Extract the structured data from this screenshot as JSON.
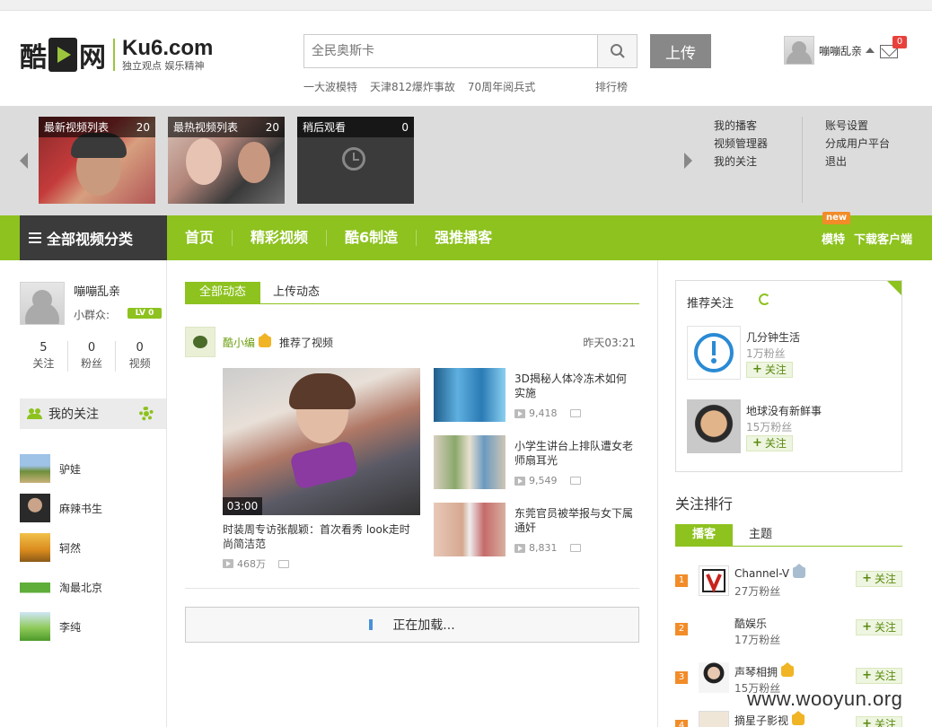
{
  "header": {
    "logo_cn1": "酷",
    "logo_cn2": "网",
    "logo_en": "Ku6.com",
    "logo_slogan": "独立观点 娱乐精神",
    "search_placeholder": "全民奥斯卡",
    "upload_label": "上传",
    "hot_links": [
      "一大波模特",
      "天津812爆炸事故",
      "70周年阅兵式"
    ],
    "rank_link": "排行榜",
    "username": "嘣嘣乱亲",
    "mail_count": "0"
  },
  "strip": {
    "lists": [
      {
        "title": "最新视频列表",
        "count": "20"
      },
      {
        "title": "最热视频列表",
        "count": "20"
      },
      {
        "title": "稍后观看",
        "count": "0"
      }
    ],
    "menu_col1": [
      "我的播客",
      "视频管理器",
      "我的关注"
    ],
    "menu_col2": [
      "账号设置",
      "分成用户平台",
      "退出"
    ]
  },
  "nav": {
    "category": "全部视频分类",
    "items": [
      "首页",
      "精彩视频",
      "酷6制造",
      "强推播客"
    ],
    "right": [
      "模特",
      "下载客户端"
    ],
    "new_badge": "new"
  },
  "profile": {
    "name": "嘣嘣乱亲",
    "group_label": "小群众:",
    "level": "LV 0",
    "stats": [
      {
        "num": "5",
        "label": "关注"
      },
      {
        "num": "0",
        "label": "粉丝"
      },
      {
        "num": "0",
        "label": "视频"
      }
    ],
    "my_follow_label": "我的关注",
    "follows": [
      "驴娃",
      "麻辣书生",
      "轲然",
      "淘最北京",
      "李纯"
    ]
  },
  "feed": {
    "tabs": [
      "全部动态",
      "上传动态"
    ],
    "user": "酷小编",
    "action": "推荐了视频",
    "time": "昨天03:21",
    "main": {
      "duration": "03:00",
      "title": "时装周专访张靓颖：首次看秀 look走时尚简洁范",
      "views": "468万"
    },
    "side": [
      {
        "title": "3D揭秘人体冷冻术如何实施",
        "views": "9,418"
      },
      {
        "title": "小学生讲台上排队遭女老师扇耳光",
        "views": "9,549"
      },
      {
        "title": "东莞官员被举报与女下属通奸",
        "views": "8,831"
      }
    ],
    "loading": "正在加载..."
  },
  "recommend": {
    "title": "推荐关注",
    "items": [
      {
        "name": "几分钟生活",
        "fans": "1万粉丝"
      },
      {
        "name": "地球没有新鲜事",
        "fans": "15万粉丝"
      }
    ],
    "follow_label": "关注"
  },
  "ranking": {
    "title": "关注排行",
    "tabs": [
      "播客",
      "主题"
    ],
    "items": [
      {
        "num": "1",
        "name": "Channel-V",
        "fans": "27万粉丝"
      },
      {
        "num": "2",
        "name": "酷娱乐",
        "fans": "17万粉丝"
      },
      {
        "num": "3",
        "name": "声琴相拥",
        "fans": "15万粉丝"
      },
      {
        "num": "4",
        "name": "摘星子影视",
        "fans": ""
      }
    ]
  },
  "watermark": "www.wooyun.org",
  "colors": {
    "accent": "#8dc21f",
    "dark": "#3b3b3b",
    "badge": "#e8413c",
    "orange": "#f28c28"
  }
}
